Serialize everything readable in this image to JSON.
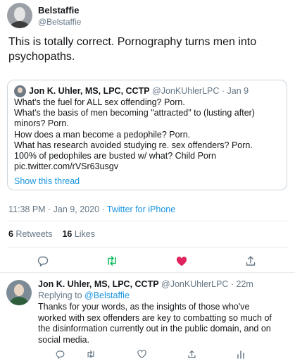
{
  "tweet": {
    "author_name": "Belstaffie",
    "author_handle": "@Belstaffie",
    "text": "This is totally correct. Pornography turns men into psychopaths.",
    "timestamp": "11:38 PM · Jan 9, 2020 · ",
    "source": "Twitter for iPhone",
    "retweets_count": "6",
    "retweets_label": " Retweets",
    "likes_count": "16",
    "likes_label": " Likes",
    "liked": true,
    "like_color": "#e0245e",
    "retweet_color": "#17bf63"
  },
  "quote": {
    "author_name": "Jon K. Uhler, MS, LPC, CCTP",
    "author_handle": " @JonKUhlerLPC · Jan 9",
    "lines": [
      "What's the fuel for ALL sex offending? Porn.",
      "What's the basis of men becoming \"attracted\" to (lusting after)",
      "minors? Porn.",
      "How does a man become a pedophile? Porn.",
      "What has research avoided studying re. sex offenders? Porn.",
      "100% of pedophiles are busted w/ what? Child Porn",
      "pic.twitter.com/rVSr63usgv"
    ],
    "show_thread": "Show this thread"
  },
  "reply": {
    "author_name": "Jon K. Uhler, MS, LPC, CCTP",
    "author_handle": " @JonKUhlerLPC · 22m",
    "replying_prefix": "Replying to ",
    "replying_mention": "@Belstaffie",
    "lines": [
      "Thanks for your words, as the insights of those who've",
      "worked with sex offenders are key to combatting so much of",
      "the disinformation currently out in the public domain, and on",
      "social media."
    ]
  },
  "icons": {
    "reply": "reply-icon",
    "retweet": "retweet-icon",
    "like": "heart-icon",
    "share": "share-icon",
    "analytics": "analytics-icon"
  }
}
